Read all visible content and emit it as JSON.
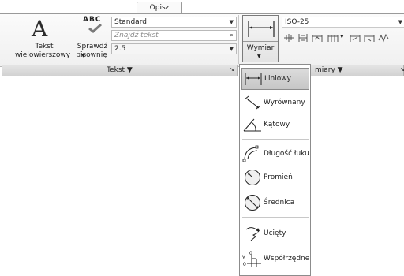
{
  "tabs": {
    "active": "Opisz"
  },
  "text_panel": {
    "big_button_line1": "Tekst",
    "big_button_line2": "wielowierszowy",
    "spell_icon_text": "ABC",
    "spell_line1": "Sprawdź",
    "spell_line2": "pisownię",
    "style_value": "Standard",
    "find_placeholder": "Znajdź tekst",
    "height_value": "2.5",
    "panel_title": "Tekst ▼",
    "panel_corner": "↘"
  },
  "dim_panel": {
    "button_label": "Wymiar",
    "style_value": "ISO-25",
    "panel_title": "Wymiary ▼",
    "panel_title_visible": "miary ▼"
  },
  "dimension_menu": {
    "items": [
      {
        "label": "Liniowy",
        "icon": "linear-dimension-icon",
        "selected": true
      },
      {
        "label": "Wyrównany",
        "icon": "aligned-dimension-icon"
      },
      {
        "label": "Kątowy",
        "icon": "angular-dimension-icon"
      },
      {
        "label": "Długość łuku",
        "icon": "arc-length-icon"
      },
      {
        "label": "Promień",
        "icon": "radius-icon"
      },
      {
        "label": "Średnica",
        "icon": "diameter-icon"
      },
      {
        "label": "Ucięty",
        "icon": "jogged-icon"
      },
      {
        "label": "Współrzędne",
        "icon": "ordinate-icon"
      }
    ]
  },
  "colors": {
    "selected_bg": "#cfcfcf",
    "panel_bar": "#d9d9d9"
  }
}
